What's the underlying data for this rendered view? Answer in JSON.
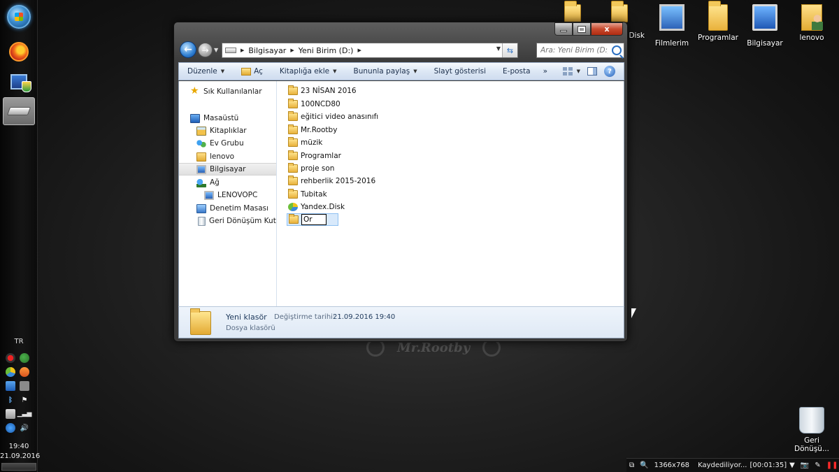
{
  "desktop": {
    "watermark": "Mr.Rootby",
    "icons": [
      {
        "label": "Disk",
        "icon": "yandex-disk-folder-icon"
      },
      {
        "label": "Filmlerim",
        "icon": "network-icon"
      },
      {
        "label": "Programlar",
        "icon": "folder-icon"
      },
      {
        "label": "Bilgisayar",
        "icon": "computer-icon"
      },
      {
        "label": "lenovo",
        "icon": "user-folder-icon"
      }
    ],
    "recycle_bin": {
      "label": "Geri Dönüşü..."
    }
  },
  "taskbar": {
    "lang": "TR",
    "time": "19:40",
    "date": "21.09.2016"
  },
  "window": {
    "caption": {
      "min": "–",
      "max": "□",
      "close": "x"
    },
    "address": {
      "crumbs": [
        "Bilgisayar",
        "Yeni Birim (D:)"
      ]
    },
    "search": {
      "placeholder": "Ara: Yeni Birim (D:)"
    },
    "toolbar": {
      "organize": "Düzenle",
      "open": "Aç",
      "include_library": "Kitaplığa ekle",
      "share_with": "Bununla paylaş",
      "slideshow": "Slayt gösterisi",
      "email": "E-posta",
      "more": "»",
      "help": "?"
    },
    "nav_pane": {
      "favorites": "Sık Kullanılanlar",
      "desktop": "Masaüstü",
      "libraries": "Kitaplıklar",
      "homegroup": "Ev Grubu",
      "user": "lenovo",
      "computer": "Bilgisayar",
      "network": "Ağ",
      "network_pc": "LENOVOPC",
      "control_panel": "Denetim Masası",
      "recycle_bin": "Geri Dönüşüm Kutusu"
    },
    "files": [
      {
        "name": "23 NİSAN 2016",
        "type": "folder"
      },
      {
        "name": "100NCD80",
        "type": "folder"
      },
      {
        "name": "eğitici video anasınıfı",
        "type": "folder"
      },
      {
        "name": "Mr.Rootby",
        "type": "folder"
      },
      {
        "name": "müzik",
        "type": "folder"
      },
      {
        "name": "Programlar",
        "type": "folder"
      },
      {
        "name": "proje son",
        "type": "folder"
      },
      {
        "name": "rehberlik 2015-2016",
        "type": "folder"
      },
      {
        "name": "Tubitak",
        "type": "folder"
      },
      {
        "name": "Yandex.Disk",
        "type": "yandex"
      }
    ],
    "rename_value": "Or",
    "details": {
      "name": "Yeni klasör",
      "modified_label": "Değiştirme tarihi:",
      "modified_value": "21.09.2016 19:40",
      "type": "Dosya klasörü"
    }
  },
  "recorder": {
    "resolution": "1366x768",
    "status": "Kaydediliyor...",
    "timer": "[00:01:35]"
  }
}
